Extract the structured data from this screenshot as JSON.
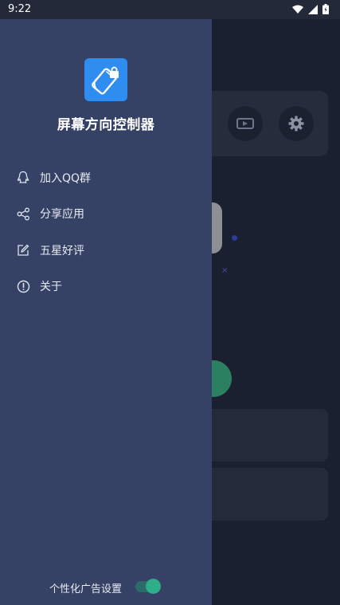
{
  "status_bar": {
    "time": "9:22"
  },
  "drawer": {
    "app_title": "屏幕方向控制器",
    "menu": [
      {
        "label": "加入QQ群",
        "icon": "qq-icon"
      },
      {
        "label": "分享应用",
        "icon": "share-icon"
      },
      {
        "label": "五星好评",
        "icon": "edit-icon"
      },
      {
        "label": "关于",
        "icon": "info-icon"
      }
    ],
    "ad_setting": {
      "label": "个性化广告设置",
      "enabled": true
    }
  },
  "colors": {
    "drawer_bg": "#354265",
    "app_bg": "#1b2030",
    "logo_blue": "#2f8df0",
    "toggle_on": "#2fae8a"
  }
}
